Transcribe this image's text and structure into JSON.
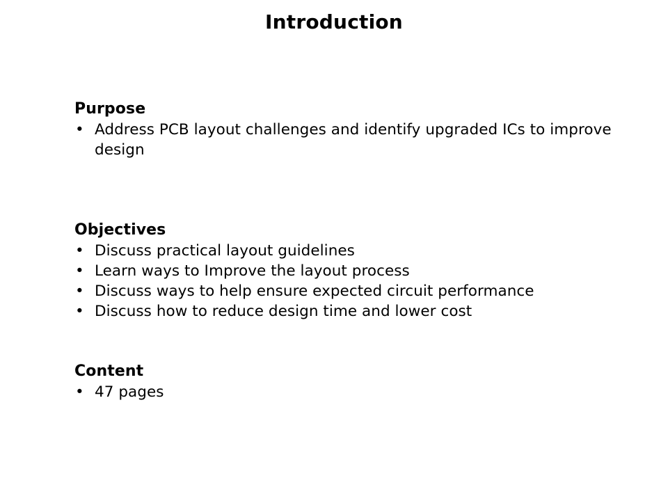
{
  "slide": {
    "title": "Introduction",
    "background_color": "#ffffff",
    "text_color": "#000000",
    "bullet_glyph": "•",
    "sections": [
      {
        "heading": "Purpose",
        "bullets": [
          "Address PCB layout challenges and identify upgraded ICs to improve design"
        ]
      },
      {
        "heading": "Objectives",
        "bullets": [
          "Discuss practical layout guidelines",
          "Learn ways to Improve the layout process",
          "Discuss ways to help ensure expected circuit performance",
          "Discuss how to reduce design time and lower cost"
        ]
      },
      {
        "heading": "Content",
        "bullets": [
          "47 pages"
        ]
      }
    ]
  }
}
